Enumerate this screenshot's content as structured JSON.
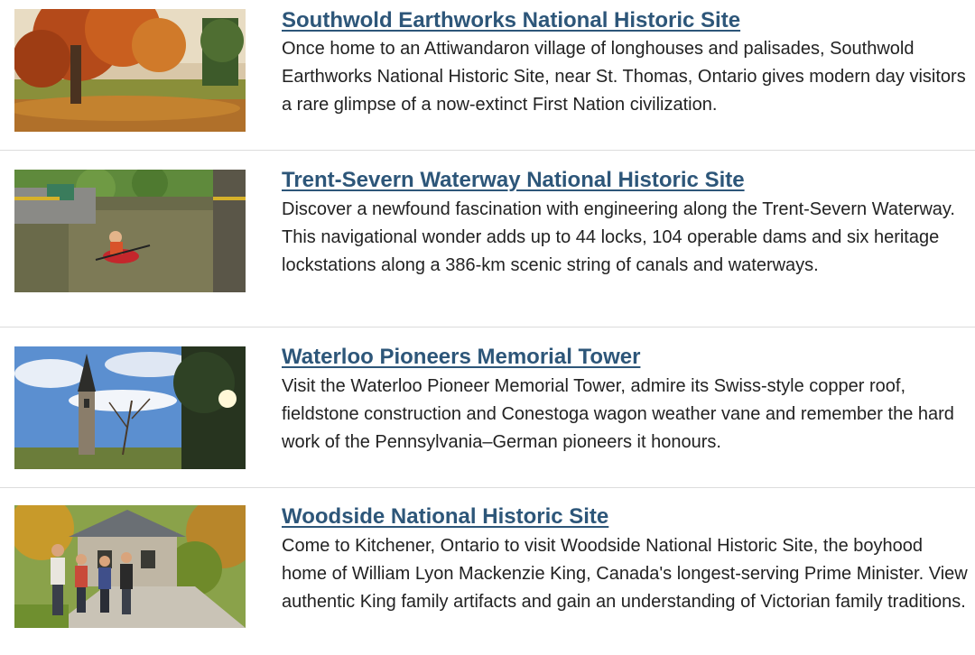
{
  "sites": [
    {
      "title": "Southwold Earthworks National Historic Site",
      "description": "Once home to an Attiwandaron village of longhouses and palisades, Southwold Earthworks National Historic Site, near St. Thomas, Ontario gives modern day visitors a rare glimpse of a now-extinct First Nation civilization."
    },
    {
      "title": "Trent-Severn Waterway National Historic Site",
      "description": "Discover a newfound fascination with engineering along the Trent-Severn Waterway. This navigational wonder adds up to 44 locks, 104 operable dams and six heritage lockstations along a 386-km scenic string of canals and waterways."
    },
    {
      "title": "Waterloo Pioneers Memorial Tower",
      "description": "Visit the Waterloo Pioneer Memorial Tower, admire its Swiss-style copper roof, fieldstone construction and Conestoga wagon weather vane and remember the hard work of the Pennsylvania–German pioneers it honours."
    },
    {
      "title": "Woodside National Historic Site",
      "description": "Come to Kitchener, Ontario to visit Woodside National Historic Site, the boyhood home of William Lyon Mackenzie King, Canada's longest-serving Prime Minister. View authentic King family artifacts and gain an understanding of Victorian family traditions."
    }
  ],
  "colors": {
    "link": "#2d5679",
    "text": "#222222",
    "divider": "#dcdcdc"
  }
}
